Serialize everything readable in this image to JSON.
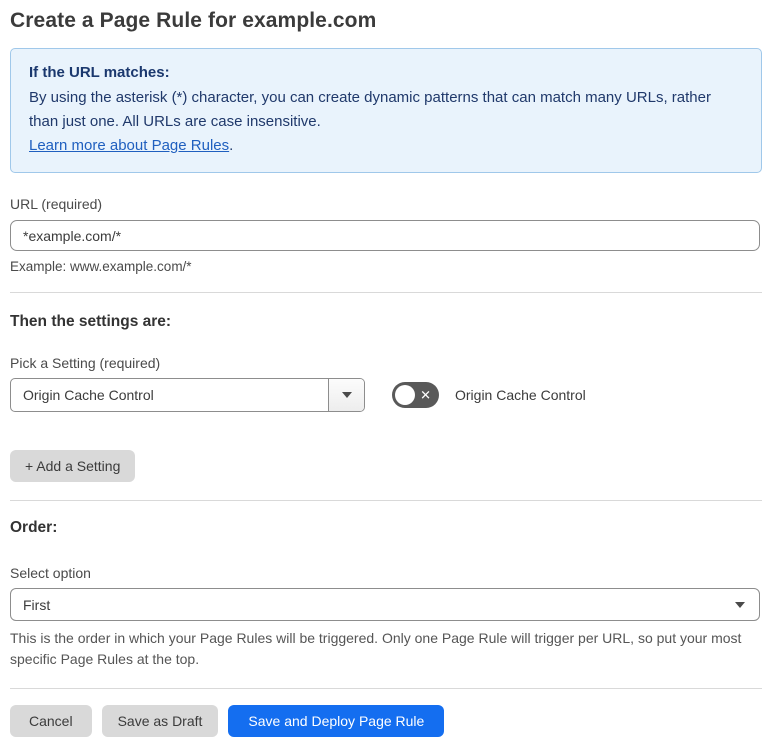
{
  "page": {
    "title": "Create a Page Rule for example.com"
  },
  "info_box": {
    "heading": "If the URL matches:",
    "body": "By using the asterisk (*) character, you can create dynamic patterns that can match many URLs, rather than just one. All URLs are case insensitive.",
    "link_label": "Learn more about Page Rules",
    "link_suffix": "."
  },
  "url_section": {
    "label": "URL (required)",
    "value": "*example.com/*",
    "example": "Example: www.example.com/*"
  },
  "settings_section": {
    "heading": "Then the settings are:",
    "pick_label": "Pick a Setting (required)",
    "selected_setting": "Origin Cache Control",
    "toggle_state": "off",
    "toggle_glyph": "✕",
    "toggle_label": "Origin Cache Control",
    "add_button_label": "+ Add a Setting"
  },
  "order_section": {
    "heading": "Order:",
    "select_label": "Select option",
    "selected_option": "First",
    "help_text": "This is the order in which your Page Rules will be triggered. Only one Page Rule will trigger per URL, so put your most specific Page Rules at the top."
  },
  "footer": {
    "cancel_label": "Cancel",
    "save_draft_label": "Save as Draft",
    "save_deploy_label": "Save and Deploy Page Rule"
  },
  "colors": {
    "accent_blue": "#146EF0",
    "info_background": "#E9F3FC",
    "info_border": "#A0C8EA",
    "info_text": "#20396B",
    "link_blue": "#1F5FBF",
    "toggle_off_gray": "#595959"
  }
}
